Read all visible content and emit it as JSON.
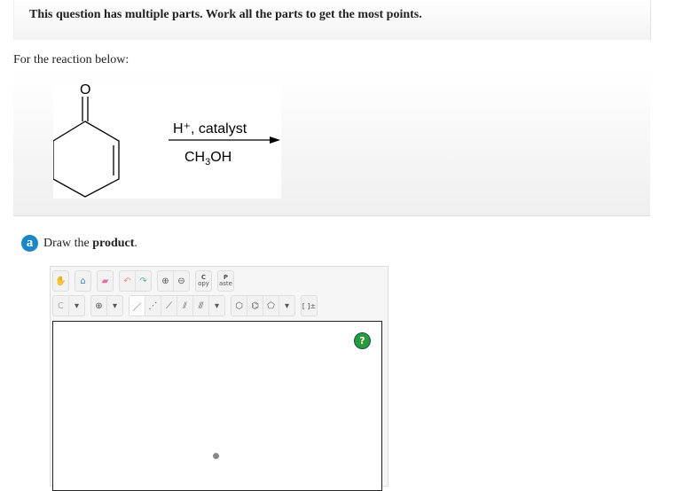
{
  "notice": "This question has multiple parts. Work all the parts to get the most points.",
  "intro": "For the reaction below:",
  "reaction": {
    "reagent_top": "H⁺, catalyst",
    "reagent_bottom_main": "CH",
    "reagent_bottom_sub": "3",
    "reagent_bottom_end": "OH",
    "atom_label": "O"
  },
  "part": {
    "letter": "a",
    "prefix": "Draw the ",
    "bold": "product",
    "suffix": "."
  },
  "toolbar": {
    "copy": "C",
    "copy_sub": "opy",
    "paste": "P",
    "paste_sub": "aste",
    "carbon": "C",
    "bracket": "[ ]±",
    "help": "?"
  }
}
